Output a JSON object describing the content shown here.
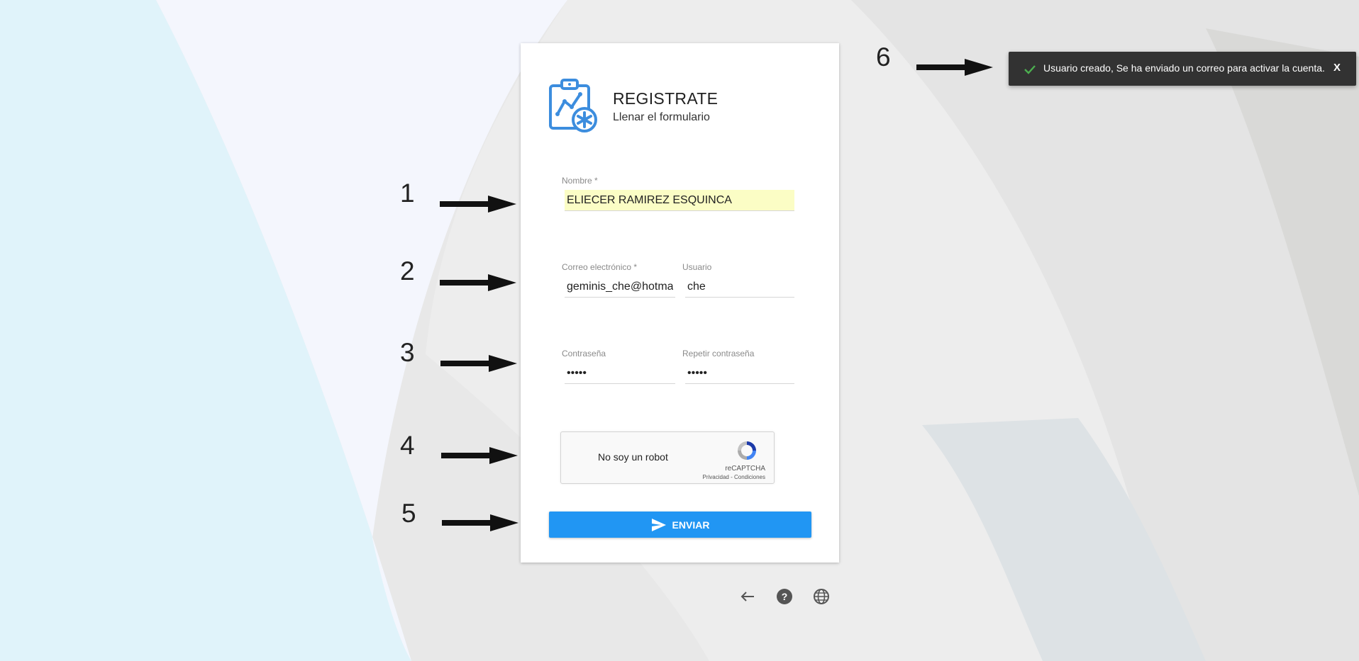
{
  "colors": {
    "primary": "#2196f3",
    "icon_blue": "#3c8dde",
    "snackbar_bg": "#323232",
    "success_check": "#4caf50",
    "autofill_bg": "#fbfdc5"
  },
  "form": {
    "logo_icon": "clipboard-chart-medical-icon",
    "title": "REGISTRATE",
    "subtitle": "Llenar el formulario",
    "nombre": {
      "label": "Nombre *",
      "value": "ELIECER RAMIREZ ESQUINCA"
    },
    "correo": {
      "label": "Correo electrónico *",
      "value": "geminis_che@hotmail.com"
    },
    "usuario": {
      "label": "Usuario",
      "value": "che"
    },
    "password": {
      "label": "Contraseña",
      "value": "•••••"
    },
    "password_repeat": {
      "label": "Repetir contraseña",
      "value": "•••••"
    },
    "captcha": {
      "label": "No soy un robot",
      "brand": "reCAPTCHA",
      "links": "Privacidad - Condiciones"
    },
    "submit": {
      "label": "ENVIAR",
      "icon": "send-icon"
    }
  },
  "footer": {
    "icons": [
      "arrow-left-icon",
      "help-icon",
      "globe-icon"
    ]
  },
  "snackbar": {
    "icon": "check-icon",
    "message": "Usuario creado, Se ha enviado un correo para activar la cuenta.",
    "close_label": "X"
  },
  "annotations": [
    "1",
    "2",
    "3",
    "4",
    "5",
    "6"
  ]
}
